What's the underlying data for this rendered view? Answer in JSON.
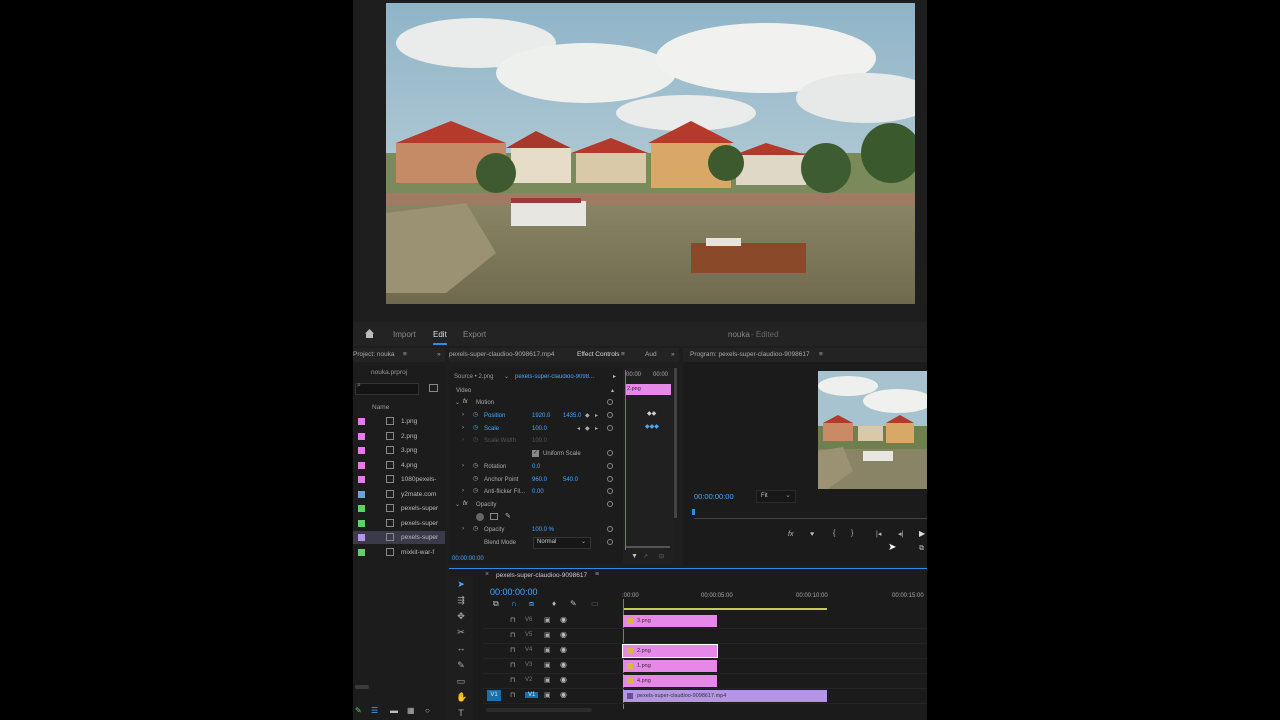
{
  "topbar": {
    "home_icon": "home-icon",
    "import": "Import",
    "edit": "Edit",
    "export": "Export",
    "project_name": "nouka",
    "status": "- Edited"
  },
  "project_panel": {
    "title": "Project: nouka",
    "file": "nouka.prproj",
    "column": "Name",
    "items": [
      {
        "name": "1.png",
        "color": "#e27de7"
      },
      {
        "name": "2.png",
        "color": "#e27de7"
      },
      {
        "name": "3.png",
        "color": "#e27de7"
      },
      {
        "name": "4.png",
        "color": "#e27de7"
      },
      {
        "name": "1080pexels-",
        "color": "#e27de7"
      },
      {
        "name": "y2mate.com",
        "color": "#6fa3d6"
      },
      {
        "name": "pexels-super",
        "color": "#5fd06b"
      },
      {
        "name": "pexels-super",
        "color": "#5fd06b"
      },
      {
        "name": "pexels-super",
        "color": "#b596e6"
      },
      {
        "name": "mixkit-war-f",
        "color": "#5fd06b"
      }
    ]
  },
  "effect_controls": {
    "source_tab": "pexels-super-claudioo-9098617.mp4",
    "tab": "Effect Controls",
    "aud_tab": "Aud",
    "source_label": "Source • 2.png",
    "source_clip": "pexels-super-claudioo-9098...",
    "timecode_start": "00:00",
    "timecode_end": "00:00",
    "clip_name": "2.png",
    "video": "Video",
    "motion": "Motion",
    "position_label": "Position",
    "position_x": "1920.0",
    "position_y": "1435.0",
    "scale_label": "Scale",
    "scale": "100.0",
    "scale_width_label": "Scale Width",
    "scale_width": "100.0",
    "uniform_scale": "Uniform Scale",
    "rotation_label": "Rotation",
    "rotation": "0.0",
    "anchor_label": "Anchor Point",
    "anchor_x": "960.0",
    "anchor_y": "540.0",
    "antiflicker_label": "Anti-flicker Fil...",
    "antiflicker": "0.00",
    "opacity_group": "Opacity",
    "opacity_label": "Opacity",
    "opacity": "100.0 %",
    "blend_label": "Blend Mode",
    "blend": "Normal",
    "footer_time": "00:00:00:00"
  },
  "program": {
    "title": "Program: pexels-super-claudioo-9098617",
    "timecode": "00:00:00:00",
    "fit": "Fit"
  },
  "timeline": {
    "title": "pexels-super-claudioo-9098617",
    "timecode": "00:00:00:00",
    "ruler": [
      ":00:00",
      "00:00:05:00",
      "00:00:10:00",
      "00:00:15:00"
    ],
    "tracks": [
      "V6",
      "V5",
      "V4",
      "V3",
      "V2",
      "V1"
    ],
    "clips": [
      {
        "label": "3.png"
      },
      {
        "label": "2.png"
      },
      {
        "label": "1.png"
      },
      {
        "label": "4.png"
      },
      {
        "label": "pexels-super-claudioo-9098617.mp4"
      }
    ]
  },
  "colors": {
    "accent": "#2d8ceb",
    "pink_clip": "#e588e8",
    "violet_clip": "#b596e6"
  }
}
